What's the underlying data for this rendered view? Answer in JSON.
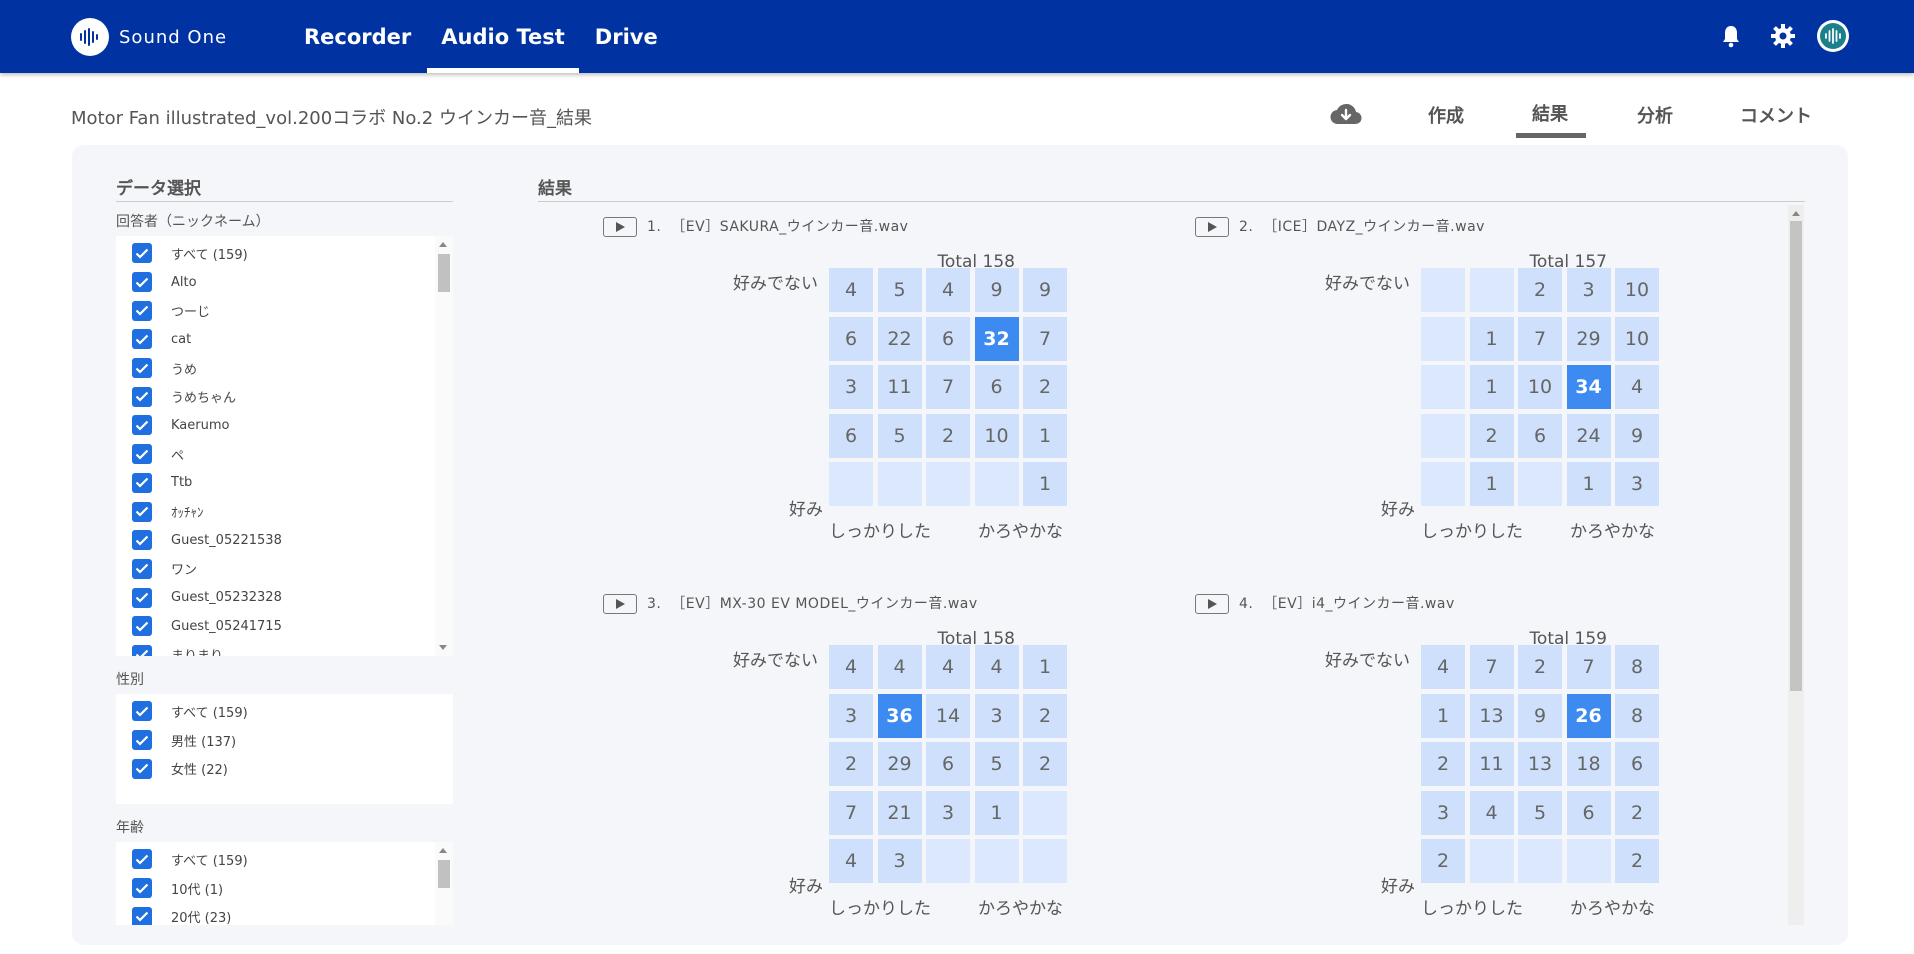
{
  "header": {
    "brand": "Sound One",
    "nav": [
      {
        "label": "Recorder",
        "active": false
      },
      {
        "label": "Audio Test",
        "active": true
      },
      {
        "label": "Drive",
        "active": false
      }
    ],
    "icons": [
      "bell-icon",
      "gear-icon",
      "avatar"
    ]
  },
  "page": {
    "title": "Motor Fan illustrated_vol.200コラボ No.2 ウインカー音_結果",
    "tabs": [
      {
        "label": "作成",
        "active": false
      },
      {
        "label": "結果",
        "active": true
      },
      {
        "label": "分析",
        "active": false
      },
      {
        "label": "コメント",
        "active": false
      }
    ]
  },
  "sidebar": {
    "title": "データ選択",
    "respondents_label": "回答者（ニックネーム）",
    "respondents": [
      "すべて (159)",
      "Alto",
      "つーじ",
      "cat",
      "うめ",
      "うめちゃん",
      "Kaerumo",
      "ペ",
      "Ttb",
      "ｵｯﾁｬﾝ",
      "Guest_05221538",
      "ワン",
      "Guest_05232328",
      "Guest_05241715",
      "まりまり"
    ],
    "gender_label": "性別",
    "gender": [
      "すべて (159)",
      "男性 (137)",
      "女性 (22)"
    ],
    "age_label": "年齢",
    "age": [
      "すべて (159)",
      "10代 (1)",
      "20代 (23)"
    ]
  },
  "results": {
    "title": "結果",
    "y_top_label": "好みでない",
    "y_bottom_label": "好み",
    "x_left_label": "しっかりした",
    "x_right_label": "かろやかな",
    "cards": [
      {
        "index": "1.",
        "name": "［EV］SAKURA_ウインカー音.wav",
        "total": "Total 158",
        "grid": [
          [
            4,
            5,
            4,
            9,
            9
          ],
          [
            6,
            22,
            6,
            32,
            7
          ],
          [
            3,
            11,
            7,
            6,
            2
          ],
          [
            6,
            5,
            2,
            10,
            1
          ],
          [
            null,
            null,
            null,
            null,
            1
          ]
        ],
        "max": 32
      },
      {
        "index": "2.",
        "name": "［ICE］DAYZ_ウインカー音.wav",
        "total": "Total 157",
        "grid": [
          [
            null,
            null,
            2,
            3,
            10
          ],
          [
            null,
            1,
            7,
            29,
            10
          ],
          [
            null,
            1,
            10,
            34,
            4
          ],
          [
            null,
            2,
            6,
            24,
            9
          ],
          [
            null,
            1,
            null,
            1,
            3
          ]
        ],
        "max": 34
      },
      {
        "index": "3.",
        "name": "［EV］MX-30 EV MODEL_ウインカー音.wav",
        "total": "Total 158",
        "grid": [
          [
            4,
            4,
            4,
            4,
            1
          ],
          [
            3,
            36,
            14,
            3,
            2
          ],
          [
            2,
            29,
            6,
            5,
            2
          ],
          [
            7,
            21,
            3,
            1,
            null
          ],
          [
            4,
            3,
            null,
            null,
            null
          ]
        ],
        "max": 36
      },
      {
        "index": "4.",
        "name": "［EV］i4_ウインカー音.wav",
        "total": "Total 159",
        "grid": [
          [
            4,
            7,
            2,
            7,
            8
          ],
          [
            1,
            13,
            9,
            26,
            8
          ],
          [
            2,
            11,
            13,
            18,
            6
          ],
          [
            3,
            4,
            5,
            6,
            2
          ],
          [
            2,
            null,
            null,
            null,
            2
          ]
        ],
        "max": 26
      }
    ]
  },
  "colors": {
    "header": "#0033a1",
    "checkbox": "#1f6fe0",
    "cell": "#cfe0fc",
    "cell_empty": "#dbe8fd",
    "cell_highlight": "#3d8bf0"
  }
}
